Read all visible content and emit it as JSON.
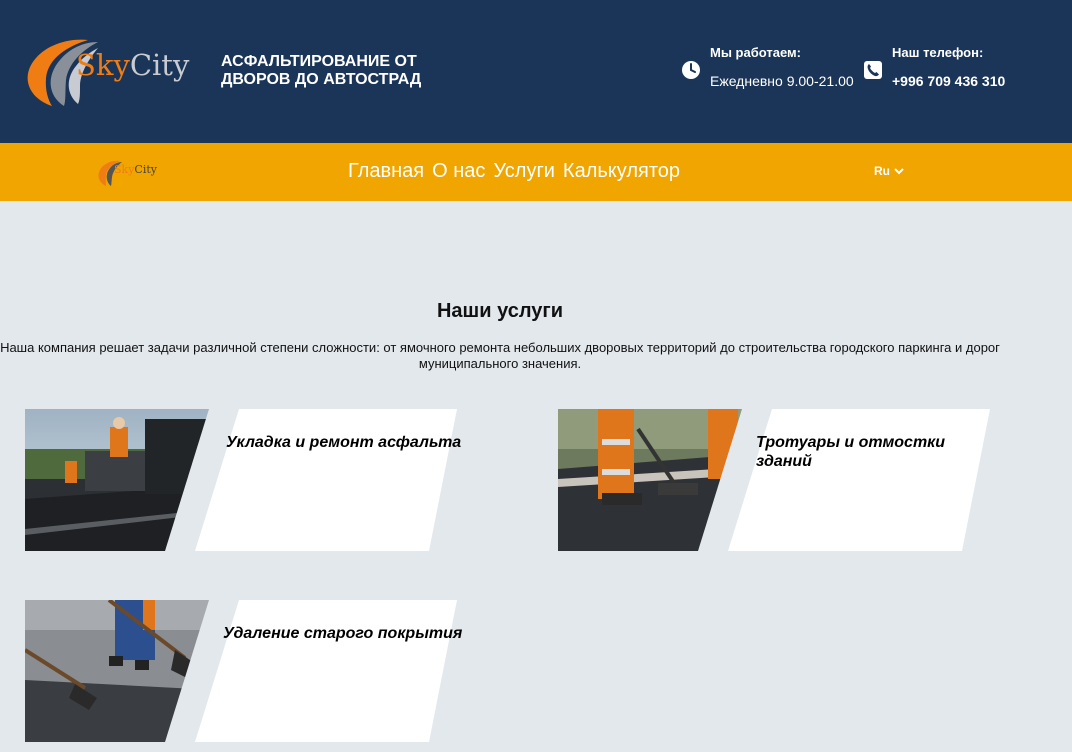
{
  "header": {
    "logo_text_sky": "Sky",
    "logo_text_city": "City",
    "tagline": "АСФАЛЬТИРОВАНИЕ ОТ ДВОРОВ ДО АВТОСТРАД",
    "hours_label": "Мы работаем:",
    "hours_value": "Ежедневно 9.00-21.00",
    "phone_label": "Наш телефон:",
    "phone_value": "+996 709 436 310"
  },
  "nav": {
    "logo_text_sky": "Sky",
    "logo_text_city": "City",
    "items": [
      {
        "label": "Главная"
      },
      {
        "label": "О нас"
      },
      {
        "label": "Услуги"
      },
      {
        "label": "Калькулятор"
      }
    ],
    "language": "Ru"
  },
  "services": {
    "title": "Наши услуги",
    "description": "Наша компания решает задачи различной степени сложности: от ямочного ремонта небольших дворовых территорий до строительства городского паркинга и дорог муниципального значения.",
    "cards": [
      {
        "title": "Укладка и ремонт асфальта"
      },
      {
        "title": "Тротуары и отмостки зданий"
      },
      {
        "title": "Удаление старого покрытия"
      }
    ]
  },
  "colors": {
    "header_bg": "#1a3557",
    "nav_bg": "#f0a500",
    "page_bg": "#e3e8ed",
    "logo_orange": "#f07d14"
  }
}
